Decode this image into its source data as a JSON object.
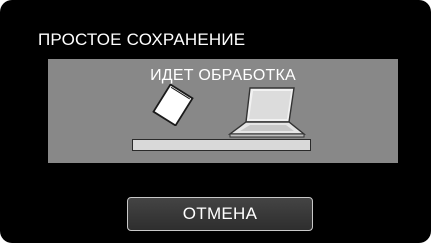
{
  "dialog": {
    "title": "ПРОСТОЕ СОХРАНЕНИЕ",
    "status": "ИДЕТ ОБРАБОТКА",
    "progress": 0,
    "icons": [
      "memory-card-icon",
      "laptop-icon"
    ]
  },
  "buttons": {
    "cancel_label": "ОТМЕНА"
  },
  "colors": {
    "background": "#000000",
    "panel": "#888888",
    "text": "#ffffff",
    "progress_track": "#d9d9d9"
  }
}
